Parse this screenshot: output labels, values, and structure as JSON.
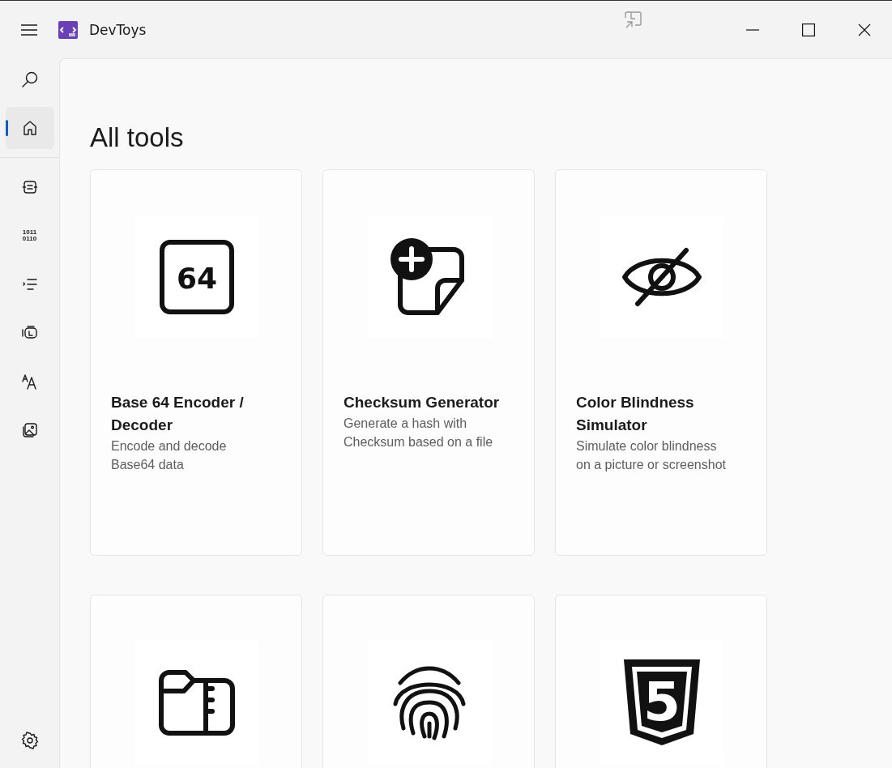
{
  "window": {
    "title": "DevToys"
  },
  "nav": {
    "top": [
      {
        "kind": "search",
        "selected": false
      },
      {
        "kind": "home",
        "selected": true
      }
    ],
    "tools": [
      {
        "kind": "converter",
        "selected": false
      },
      {
        "kind": "binary",
        "selected": false,
        "icon_text": [
          "1011",
          "0110"
        ]
      },
      {
        "kind": "formatter",
        "selected": false
      },
      {
        "kind": "generator",
        "selected": false
      },
      {
        "kind": "text",
        "selected": false
      },
      {
        "kind": "graphic",
        "selected": false
      }
    ],
    "bottom": [
      {
        "kind": "settings",
        "selected": false
      }
    ]
  },
  "page": {
    "heading": "All tools",
    "cards": [
      {
        "kind": "encoder",
        "icon_text": "64",
        "title": "Base 64 Encoder / Decoder",
        "description": "Encode and decode Base64 data"
      },
      {
        "kind": "checksum",
        "title": "Checksum Generator",
        "description": "Generate a hash with Checksum based on a file"
      },
      {
        "kind": "vision",
        "title": "Color Blindness Simulator",
        "description": "Simulate color blindness on a picture or screenshot"
      },
      {
        "kind": "archive"
      },
      {
        "kind": "fingerprint"
      },
      {
        "kind": "html",
        "icon_text": "5"
      }
    ]
  }
}
